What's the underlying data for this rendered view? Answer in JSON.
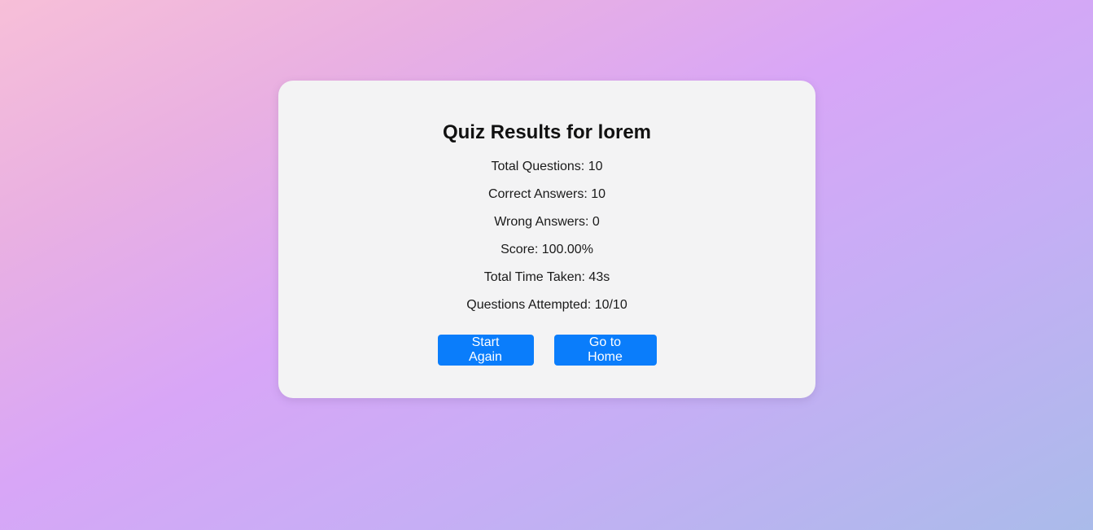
{
  "results": {
    "title": "Quiz Results for lorem",
    "stats": [
      "Total Questions: 10",
      "Correct Answers: 10",
      "Wrong Answers: 0",
      "Score: 100.00%",
      "Total Time Taken: 43s",
      "Questions Attempted: 10/10"
    ]
  },
  "actions": {
    "start_again_label": "Start Again",
    "go_home_label": "Go to Home"
  },
  "colors": {
    "button": "#0a7dfb",
    "card": "#f3f3f4"
  }
}
